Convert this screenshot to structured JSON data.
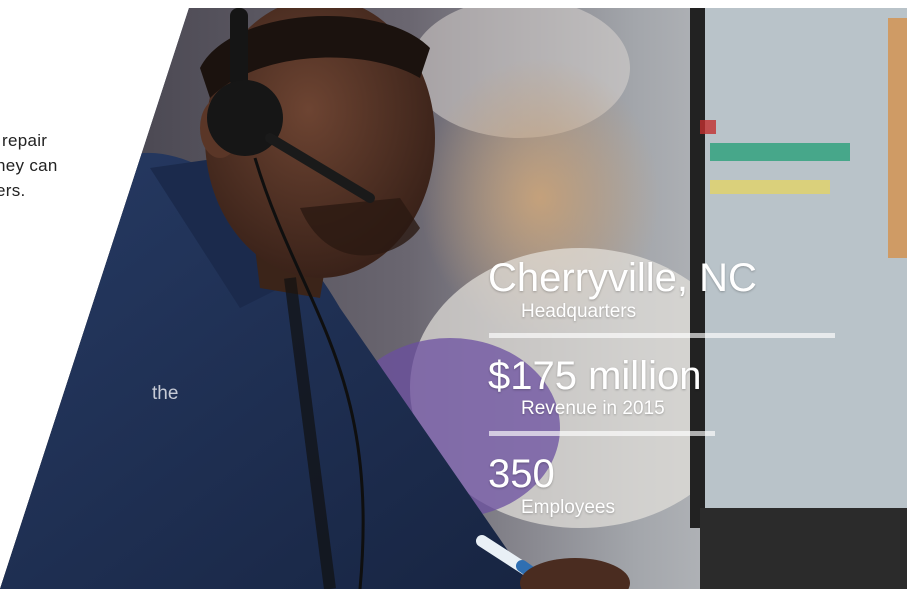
{
  "intro_fragment": {
    "line1": "repair",
    "line2": "ney can",
    "line3": "ers."
  },
  "stray_word": "the",
  "stats": [
    {
      "value": "Cherryville, NC",
      "label": "Headquarters"
    },
    {
      "value": "$175 million",
      "label": "Revenue in 2015"
    },
    {
      "value": "350",
      "label": "Employees"
    }
  ],
  "colors": {
    "text_dark": "#222222",
    "jacket_navy": "#1f2d4d",
    "overlay_text": "#ffffff"
  },
  "icons": [
    "headset-icon",
    "pen-icon"
  ]
}
